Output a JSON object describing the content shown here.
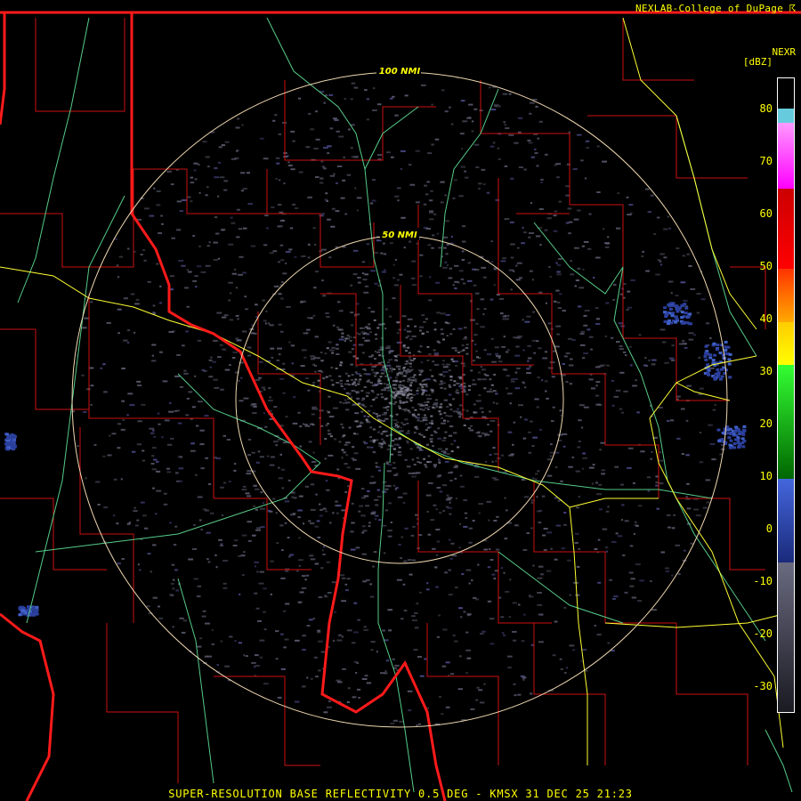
{
  "header": {
    "credit": "NEXLAB-College of DuPage ☈"
  },
  "legend": {
    "product": "NEXR",
    "units": "[dBZ]",
    "ticks": [
      "80",
      "70",
      "60",
      "50",
      "40",
      "30",
      "20",
      "10",
      "0",
      "-10",
      "-20",
      "-30"
    ],
    "colors": {
      "noise": "#5a5a6e",
      "light": "#2b3f9c",
      "green": "#1a7a1a",
      "yellow": "#ffff00",
      "orange": "#ff8c00",
      "red": "#ff0000",
      "magenta": "#ff00ff",
      "cyan": "#66ccdd"
    }
  },
  "map": {
    "range_rings": [
      "100 NMI",
      "50 NMI"
    ],
    "colors": {
      "state_border": "#ff1a1a",
      "county_border": "#cc1111",
      "river": "#55cc88",
      "highway": "#ffff33",
      "ring": "#f0d8b0"
    }
  },
  "footer": {
    "caption": "SUPER-RESOLUTION BASE REFLECTIVITY 0.5 DEG - KMSX 31 DEC 25 21:23"
  }
}
